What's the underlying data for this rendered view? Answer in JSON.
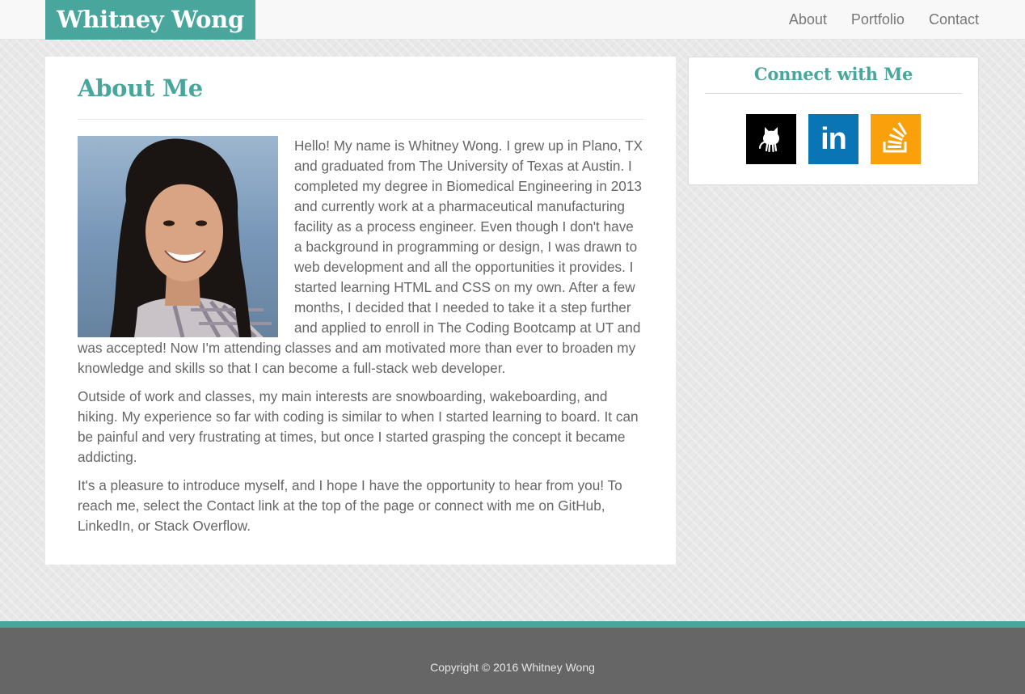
{
  "brand": {
    "name": "Whitney Wong"
  },
  "nav": {
    "links": [
      "About",
      "Portfolio",
      "Contact"
    ]
  },
  "about": {
    "title": "About Me",
    "paragraphs": [
      "Hello! My name is Whitney Wong. I grew up in Plano, TX and graduated from The University of Texas at Austin. I completed my degree in Biomedical Engineering in 2013 and currently work at a pharmaceutical manufacturing facility as a process engineer. Even though I don't have a background in programming or design, I was drawn to web development and all the opportunities it provides. I started learning HTML and CSS on my own. After a few months, I decided that I needed to take it a step further and applied to enroll in The Coding Bootcamp at UT and was accepted! Now I'm attending classes and am motivated more than ever to broaden my knowledge and skills so that I can become a full-stack web developer.",
      "Outside of work and classes, my main interests are snowboarding, wakeboarding, and hiking. My experience so far with coding is similar to when I started learning to board. It can be painful and very frustrating at times, but once I started grasping the concept it became addicting.",
      "It's a pleasure to introduce myself, and I hope I have the opportunity to hear from you! To reach me, select the Contact link at the top of the page or connect with me on GitHub, LinkedIn, or Stack Overflow."
    ]
  },
  "connect": {
    "title": "Connect with Me",
    "links": [
      {
        "icon": "github-icon",
        "bg": "#000000"
      },
      {
        "icon": "linkedin-icon",
        "bg": "#0a75b5",
        "text": "in"
      },
      {
        "icon": "stackoverflow-icon",
        "bg": "#f9a00b"
      }
    ]
  },
  "colors": {
    "accent": "#48a69c",
    "footer": "#666666",
    "text": "#666666"
  },
  "footer": {
    "copyright": "Copyright © 2016 Whitney Wong"
  }
}
